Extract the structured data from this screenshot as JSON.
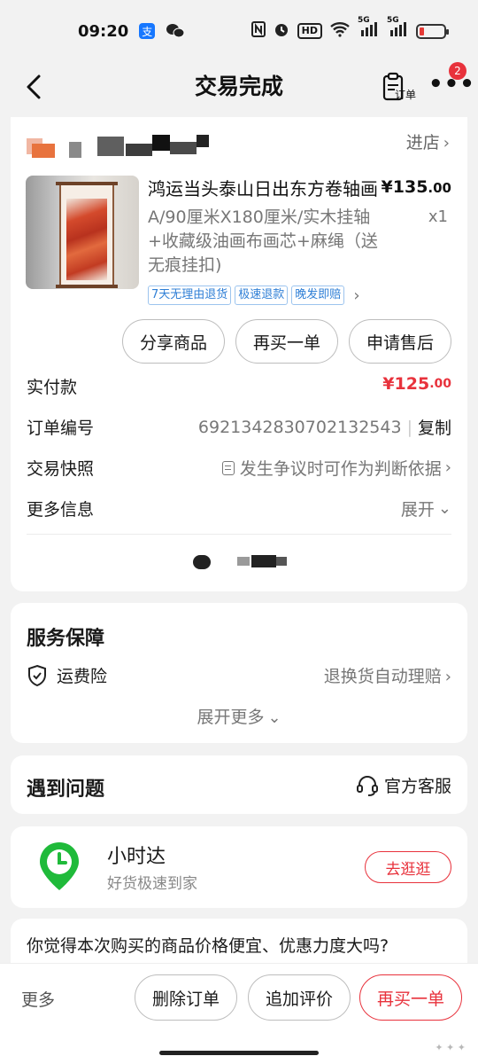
{
  "status_bar": {
    "time": "09:20",
    "app_icons": [
      "alipay-icon",
      "wechat-icon"
    ],
    "right_items": [
      "nfc-icon",
      "alarm-icon",
      "hd-icon",
      "wifi-icon",
      "5g-signal-icon",
      "5g-signal-icon",
      "battery-icon"
    ],
    "hd_label": "HD",
    "net1": "5G",
    "net2": "5G",
    "battery_color": "#e53935"
  },
  "nav": {
    "title": "交易完成",
    "order_label": "订单",
    "badge_count": "2"
  },
  "store": {
    "link": "进店"
  },
  "product": {
    "title": "鸿运当头泰山日出东方卷轴画",
    "price_main": "¥135",
    "price_decimal": ".00",
    "spec": "A/90厘米X180厘米/实木挂轴+收藏级油画布画芯+麻绳（送无痕挂扣)",
    "qty": "x1",
    "tags": [
      "7天无理由退货",
      "极速退款",
      "晚发即赔"
    ]
  },
  "actions": {
    "share": "分享商品",
    "rebuy": "再买一单",
    "after_sale": "申请售后"
  },
  "order_info": {
    "paid_label": "实付款",
    "paid_main": "¥125",
    "paid_decimal": ".00",
    "order_no_label": "订单编号",
    "order_no": "6921342830702132543",
    "copy": "复制",
    "snapshot_label": "交易快照",
    "snapshot_text": "发生争议时可作为判断依据",
    "more_label": "更多信息",
    "expand": "展开"
  },
  "service": {
    "title": "服务保障",
    "insurance": "运费险",
    "insurance_desc": "退换货自动理赔",
    "expand_more": "展开更多"
  },
  "problem": {
    "title": "遇到问题",
    "customer_service": "官方客服"
  },
  "promo": {
    "name": "小时达",
    "sub": "好货极速到家",
    "button": "去逛逛",
    "logo_color": "#1fba3a"
  },
  "survey": {
    "question": "你觉得本次购买的商品价格便宜、优惠力度大吗?"
  },
  "bottom": {
    "more": "更多",
    "delete": "删除订单",
    "review": "追加评价",
    "rebuy": "再买一单",
    "accent": "#e8323c"
  }
}
